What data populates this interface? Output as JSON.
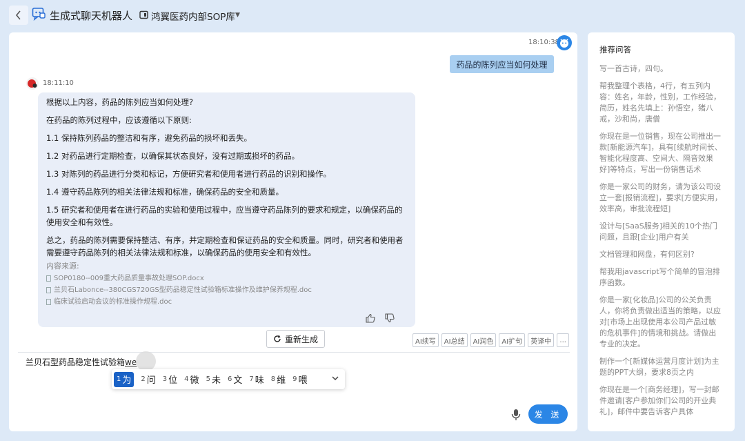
{
  "header": {
    "back_icon": "chevron-left",
    "title": "生成式聊天机器人",
    "kb_name": "鸿翼医药内部SOP库"
  },
  "chat": {
    "user_time": "18:10:38",
    "user_message": "药品的陈列应当如何处理",
    "bot_time": "18:11:10",
    "bot_paragraphs": [
      "根据以上内容，药品的陈列应当如何处理?",
      "在药品的陈列过程中，应该遵循以下原则:",
      "1.1 保持陈列药品的整洁和有序，避免药品的损坏和丢失。",
      "1.2 对药品进行定期检查，以确保其状态良好，没有过期或损坏的药品。",
      "1.3 对陈列的药品进行分类和标记，方便研究者和使用者进行药品的识别和操作。",
      "1.4 遵守药品陈列的相关法律法规和标准，确保药品的安全和质量。",
      "1.5 研究者和使用者在进行药品的实验和使用过程中，应当遵守药品陈列的要求和规定，以确保药品的使用安全和有效性。",
      "总之，药品的陈列需要保持整洁、有序，并定期检查和保证药品的安全和质量。同时，研究者和使用者需要遵守药品陈列的相关法律法规和标准，以确保药品的使用安全和有效性。"
    ],
    "sources_title": "内容来源:",
    "sources": [
      "SOP0180--009重大药品质量事故处理SOP.docx",
      "兰贝石Labonce--380CGS720GS型药品稳定性试验箱标准操作及维护保养规程.doc",
      "临床试验启动会议的标准操作规程.doc"
    ],
    "regenerate_label": "重新生成",
    "tools": [
      "AI续写",
      "AI总结",
      "AI润色",
      "AI扩句",
      "英译中",
      "..."
    ],
    "input_committed": "兰贝石型药品稳定性试验箱",
    "input_composing": "we",
    "ime_candidates": [
      {
        "num": "1",
        "text": "为"
      },
      {
        "num": "2",
        "text": "问"
      },
      {
        "num": "3",
        "text": "位"
      },
      {
        "num": "4",
        "text": "微"
      },
      {
        "num": "5",
        "text": "未"
      },
      {
        "num": "6",
        "text": "文"
      },
      {
        "num": "7",
        "text": "味"
      },
      {
        "num": "8",
        "text": "维"
      },
      {
        "num": "9",
        "text": "喂"
      }
    ],
    "send_label": "发 送"
  },
  "recommend": {
    "title": "推荐问答",
    "items": [
      "写一首古诗，四句。",
      "帮我整理个表格，4行，有五列内容：姓名，年龄，性别，工作经验，简历，姓名先填上：孙悟空，猪八戒，沙和尚，唐僧",
      "你现在是一位销售，现在公司推出一款[新能源汽车]，具有[续航时间长、智能化程度高、空间大、隔音效果好]等特点，写出一份销售话术",
      "你是一家公司的财务，请为该公司设立一套[报销流程]，要求[方便实用，效率高，审批流程短]",
      "设计与[SaaS服务]相关的10个热门问题，且跟[企业]用户有关",
      "文档管理和网盘，有何区别?",
      "帮我用javascript写个简单的冒泡排序函数。",
      "你是一家[化妆品]公司的公关负责人，你将负责做出适当的策略，以应对[市场上出现使用本公司产品过敏的危机事件]的情境和挑战。请做出专业的决定。",
      "制作一个[新媒体运营月度计划]为主题的PPT大纲，要求8页之内",
      "你现在是一个[商务经理]，写一封邮件邀请[客户参加你们公司的开业典礼]，邮件中要告诉客户具体"
    ]
  },
  "colors": {
    "background": "#dde9f7",
    "user_bubble": "#a9cff1",
    "bot_bubble": "#e9eef8",
    "send_button": "#2b86e6",
    "ime_selected": "#1a62c6"
  }
}
